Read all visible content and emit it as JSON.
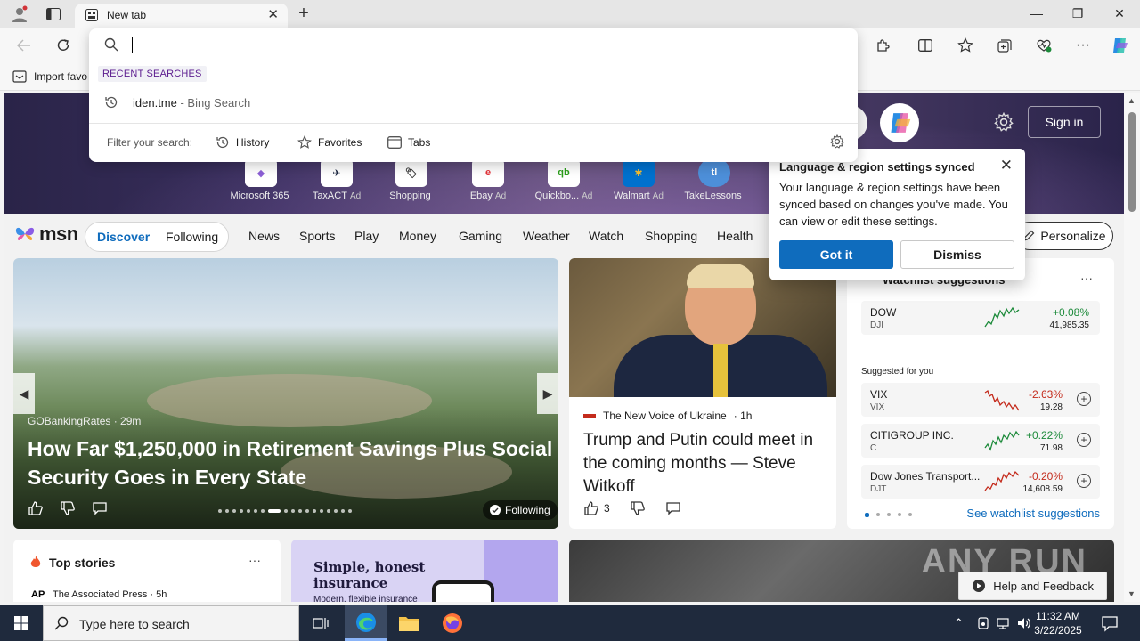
{
  "browser": {
    "tab_title": "New tab",
    "favorites_bar": {
      "import_label": "Import favo"
    }
  },
  "omnibox": {
    "value": "",
    "recent_label": "RECENT SEARCHES",
    "suggestion": {
      "query": "iden.tme",
      "source": " - Bing Search"
    },
    "filter_label": "Filter your search:",
    "filters": [
      "History",
      "Favorites",
      "Tabs"
    ]
  },
  "hero_bar": {
    "sign_in": "Sign in",
    "quicklinks": [
      {
        "label": "Microsoft 365",
        "ad": ""
      },
      {
        "label": "TaxACT",
        "ad": "Ad"
      },
      {
        "label": "Shopping",
        "ad": ""
      },
      {
        "label": "Ebay",
        "ad": "Ad"
      },
      {
        "label": "Quickbo...",
        "ad": "Ad"
      },
      {
        "label": "Walmart",
        "ad": "Ad"
      },
      {
        "label": "TakeLessons",
        "ad": ""
      }
    ]
  },
  "msn": {
    "logo": "msn",
    "feed_toggle": {
      "discover": "Discover",
      "following": "Following"
    },
    "nav": [
      "News",
      "Sports",
      "Play",
      "Money",
      "Gaming",
      "Weather",
      "Watch",
      "Shopping",
      "Health"
    ],
    "personalize": "Personalize"
  },
  "popup": {
    "title": "Language & region settings synced",
    "body": "Your language & region settings have been synced based on changes you've made. You can view or edit these settings.",
    "got_it": "Got it",
    "dismiss": "Dismiss"
  },
  "hero_card": {
    "source": "GOBankingRates · 29m",
    "title": "How Far $1,250,000 in Retirement Savings Plus Social Security Goes in Every State",
    "following": "Following"
  },
  "news_card": {
    "source": "The New Voice of Ukraine",
    "time": "· 1h",
    "title": "Trump and Putin could meet in the coming months — Steve Witkoff",
    "likes": "3"
  },
  "watchlist": {
    "title": "Watchlist suggestions",
    "more": "···",
    "suggested_label": "Suggested for you",
    "see_all": "See watchlist suggestions",
    "stocks": [
      {
        "name": "DOW",
        "symbol": "DJI",
        "change": "+0.08%",
        "price": "41,985.35",
        "trend": "up"
      },
      {
        "name": "VIX",
        "symbol": "VIX",
        "change": "-2.63%",
        "price": "19.28",
        "trend": "down"
      },
      {
        "name": "CITIGROUP INC.",
        "symbol": "C",
        "change": "+0.22%",
        "price": "71.98",
        "trend": "up"
      },
      {
        "name": "Dow Jones Transport...",
        "symbol": "DJT",
        "change": "-0.20%",
        "price": "14,608.59",
        "trend": "down"
      }
    ]
  },
  "top_stories": {
    "title": "Top stories",
    "more": "···",
    "ap": "AP",
    "source": "The Associated Press · 5h"
  },
  "ad_card": {
    "title": "Simple, honest insurance",
    "subtitle": "Modern, flexible insurance"
  },
  "watermark": "ANY RUN",
  "help": "Help and Feedback",
  "taskbar": {
    "search_placeholder": "Type here to search",
    "time": "11:32 AM",
    "date": "3/22/2025"
  },
  "colors": {
    "accent": "#0f6cbd",
    "positive": "#1c8a3a",
    "negative": "#c42b1c"
  }
}
